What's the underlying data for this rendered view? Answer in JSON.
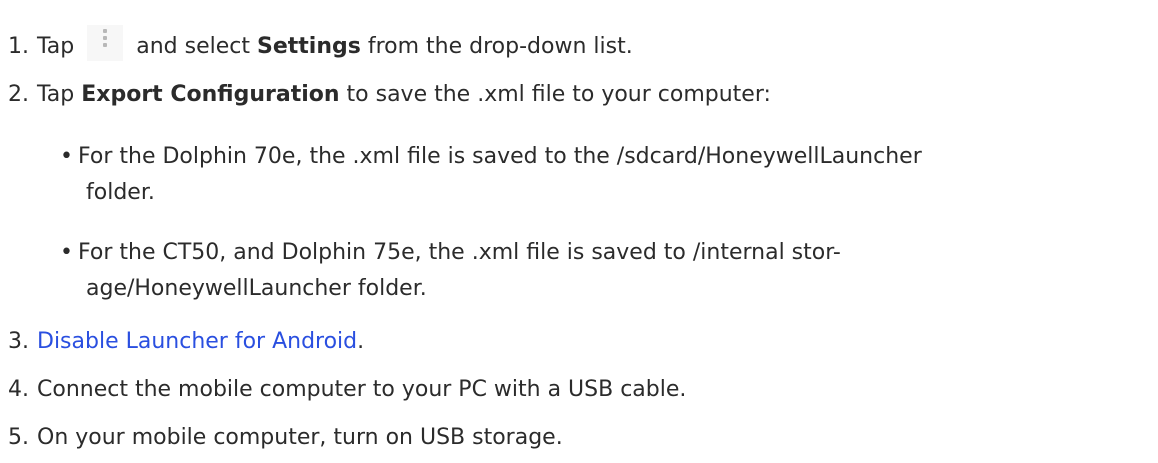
{
  "steps": [
    {
      "num": "1.",
      "text_before": "Tap",
      "icon": "overflow-menu-icon",
      "text_middle": "and select",
      "bold": "Settings",
      "text_after": "from the drop-down list."
    },
    {
      "num": "2.",
      "text_before": "Tap",
      "bold": "Export Configuration",
      "text_after": "to save the .xml file to your computer:"
    },
    {
      "num": "3.",
      "link": "Disable Launcher for Android",
      "text_after": "."
    },
    {
      "num": "4.",
      "text": "Connect the mobile computer to your PC with a USB cable."
    },
    {
      "num": "5.",
      "text": "On your mobile computer, turn on USB storage."
    }
  ],
  "bullets": [
    {
      "line1": "For the Dolphin 70e, the .xml file is saved to the /sdcard/HoneywellLauncher",
      "line2": "folder."
    },
    {
      "line1": "For the CT50, and Dolphin 75e, the .xml file is saved to /internal stor-",
      "line2": "age/HoneywellLauncher folder."
    }
  ],
  "colors": {
    "text": "#2b2b2b",
    "link": "#2a4fe0"
  }
}
